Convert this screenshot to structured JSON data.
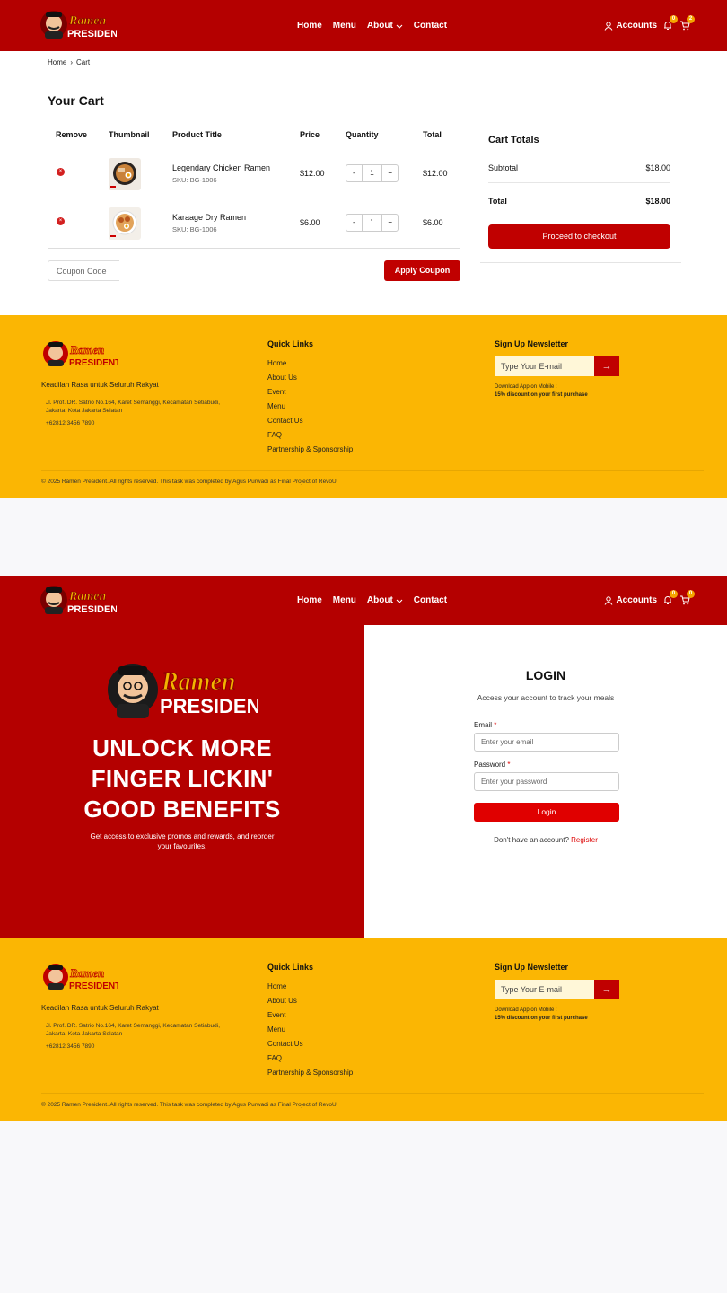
{
  "brand": {
    "line1": "Ramen",
    "line2": "PRESIDENT"
  },
  "nav": {
    "home": "Home",
    "menu": "Menu",
    "about": "About",
    "contact": "Contact",
    "accounts": "Accounts"
  },
  "header1": {
    "notif_count": "0",
    "cart_count": "2"
  },
  "header2": {
    "notif_count": "0",
    "cart_count": "0"
  },
  "breadcrumb": {
    "home": "Home",
    "current": "Cart"
  },
  "cart": {
    "title": "Your Cart",
    "columns": {
      "remove": "Remove",
      "thumbnail": "Thumbnail",
      "product": "Product Title",
      "price": "Price",
      "quantity": "Quantity",
      "total": "Total"
    },
    "items": [
      {
        "name": "Legendary Chicken Ramen",
        "sku": "SKU: BG-1006",
        "price": "$12.00",
        "qty": "1",
        "total": "$12.00"
      },
      {
        "name": "Karaage Dry Ramen",
        "sku": "SKU: BG-1006",
        "price": "$6.00",
        "qty": "1",
        "total": "$6.00"
      }
    ],
    "coupon_placeholder": "Coupon Code",
    "apply_label": "Apply Coupon",
    "minus": "-",
    "plus": "+",
    "remove_glyph": "×"
  },
  "totals": {
    "title": "Cart Totals",
    "subtotal_label": "Subtotal",
    "subtotal_value": "$18.00",
    "total_label": "Total",
    "total_value": "$18.00",
    "checkout_label": "Proceed to checkout"
  },
  "footer": {
    "tagline": "Keadilan Rasa untuk Seluruh Rakyat",
    "address": "Jl. Prof. DR. Satrio No.164, Karet Semanggi, Kecamatan Setiabudi, Jakarta, Kota Jakarta Selatan",
    "phone": "+62812 3456 7890",
    "quick_links_title": "Quick Links",
    "quick_links": [
      "Home",
      "About Us",
      "Event",
      "Menu",
      "Contact Us",
      "FAQ",
      "Partnership & Sponsorship"
    ],
    "newsletter_title": "Sign Up Newsletter",
    "newsletter_placeholder": "Type Your E-mail",
    "newsletter_button": "→",
    "download_line1": "Download App on Mobile :",
    "download_line2": "15% discount on your first purchase",
    "copyright": "© 2025 Ramen President. All rights reserved. This task was completed by Agus Purwadi as Final Project of RevoU"
  },
  "login": {
    "headline_1": "UNLOCK MORE",
    "headline_2": "FINGER LICKIN'",
    "headline_3": "GOOD BENEFITS",
    "subtext": "Get access to exclusive promos and rewards, and reorder your favourites.",
    "title": "LOGIN",
    "subtitle": "Access your account to track your meals",
    "email_label": "Email",
    "email_placeholder": "Enter your email",
    "password_label": "Password",
    "password_placeholder": "Enter your password",
    "required_mark": "*",
    "button": "Login",
    "no_account": "Don't have an account?",
    "register": "Register"
  },
  "colors": {
    "header_red": "#b40000",
    "button_red": "#c00000",
    "footer_yellow": "#fbb603"
  },
  "icons": [
    "user-icon",
    "bell-icon",
    "cart-icon",
    "chevron-down-icon",
    "remove-icon",
    "arrow-right-icon"
  ]
}
